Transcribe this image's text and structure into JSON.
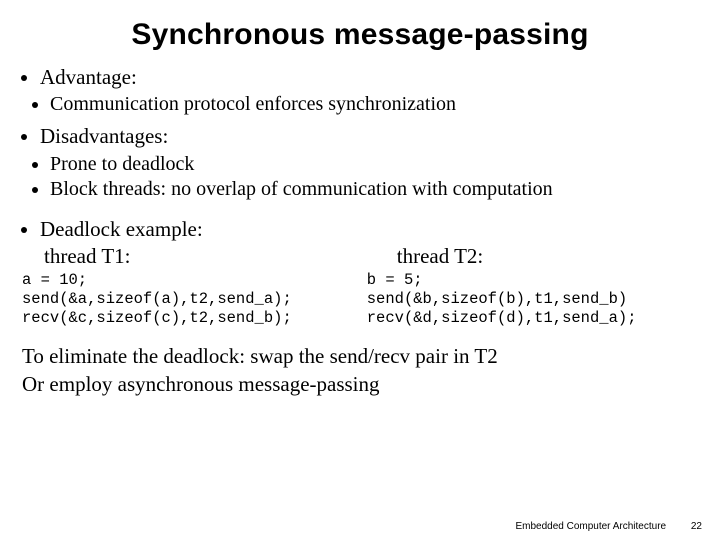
{
  "title": "Synchronous message-passing",
  "advantage": {
    "heading": "Advantage:",
    "items": [
      "Communication protocol enforces synchronization"
    ]
  },
  "disadvantages": {
    "heading": "Disadvantages:",
    "items": [
      "Prone to deadlock",
      "Block threads: no overlap of communication with computation"
    ]
  },
  "deadlock": {
    "heading": "Deadlock example:",
    "t1_label": "thread T1:",
    "t2_label": "thread T2:",
    "t1_code": "a = 10;\nsend(&a,sizeof(a),t2,send_a);\nrecv(&c,sizeof(c),t2,send_b);",
    "t2_code": "b = 5;\nsend(&b,sizeof(b),t1,send_b)\nrecv(&d,sizeof(d),t1,send_a);"
  },
  "conclusion_line1": "To eliminate the deadlock: swap the send/recv pair in T2",
  "conclusion_line2": "Or employ asynchronous message-passing",
  "footer": {
    "course": "Embedded Computer Architecture",
    "page": "22"
  }
}
